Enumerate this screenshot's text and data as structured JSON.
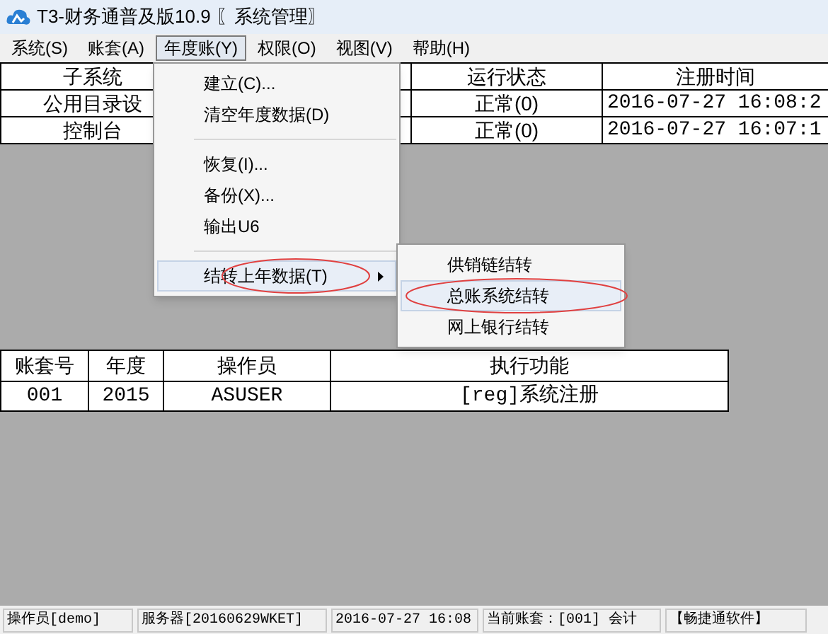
{
  "window": {
    "title": "T3-财务通普及版10.9 〖系统管理〗"
  },
  "menubar": [
    {
      "label": "系统(S)",
      "selected": false
    },
    {
      "label": "账套(A)",
      "selected": false
    },
    {
      "label": "年度账(Y)",
      "selected": true
    },
    {
      "label": "权限(O)",
      "selected": false
    },
    {
      "label": "视图(V)",
      "selected": false
    },
    {
      "label": "帮助(H)",
      "selected": false
    }
  ],
  "top_table": {
    "columns": [
      "子系统",
      "运行状态",
      "注册时间"
    ],
    "rows": [
      [
        "公用目录设",
        "正常(0)",
        "2016-07-27 16:08:2"
      ],
      [
        "控制台",
        "正常(0)",
        "2016-07-27 16:07:1"
      ]
    ]
  },
  "menu": [
    {
      "kind": "item",
      "label": "建立(C)...",
      "highlighted": false,
      "submenu": false,
      "circled": false
    },
    {
      "kind": "item",
      "label": "清空年度数据(D)",
      "highlighted": false,
      "submenu": false,
      "circled": false
    },
    {
      "kind": "separator"
    },
    {
      "kind": "item",
      "label": "恢复(I)...",
      "highlighted": false,
      "submenu": false,
      "circled": false
    },
    {
      "kind": "item",
      "label": "备份(X)...",
      "highlighted": false,
      "submenu": false,
      "circled": false
    },
    {
      "kind": "item",
      "label": "输出U6",
      "highlighted": false,
      "submenu": false,
      "circled": false
    },
    {
      "kind": "separator"
    },
    {
      "kind": "item",
      "label": "结转上年数据(T)",
      "highlighted": true,
      "submenu": true,
      "circled": true
    }
  ],
  "submenu": [
    {
      "label": "供销链结转",
      "highlighted": false,
      "circled": false
    },
    {
      "label": "总账系统结转",
      "highlighted": true,
      "circled": true
    },
    {
      "label": "网上银行结转",
      "highlighted": false,
      "circled": false
    }
  ],
  "log_table": {
    "columns": [
      "账套号",
      "年度",
      "操作员",
      "执行功能"
    ],
    "rows": [
      [
        "001",
        "2015",
        "ASUSER",
        "[reg]系统注册"
      ]
    ]
  },
  "status_bar": [
    "操作员[demo]",
    "服务器[20160629WKET]",
    "2016-07-27 16:08",
    "当前账套：[001] 会计",
    "【畅捷通软件】"
  ]
}
